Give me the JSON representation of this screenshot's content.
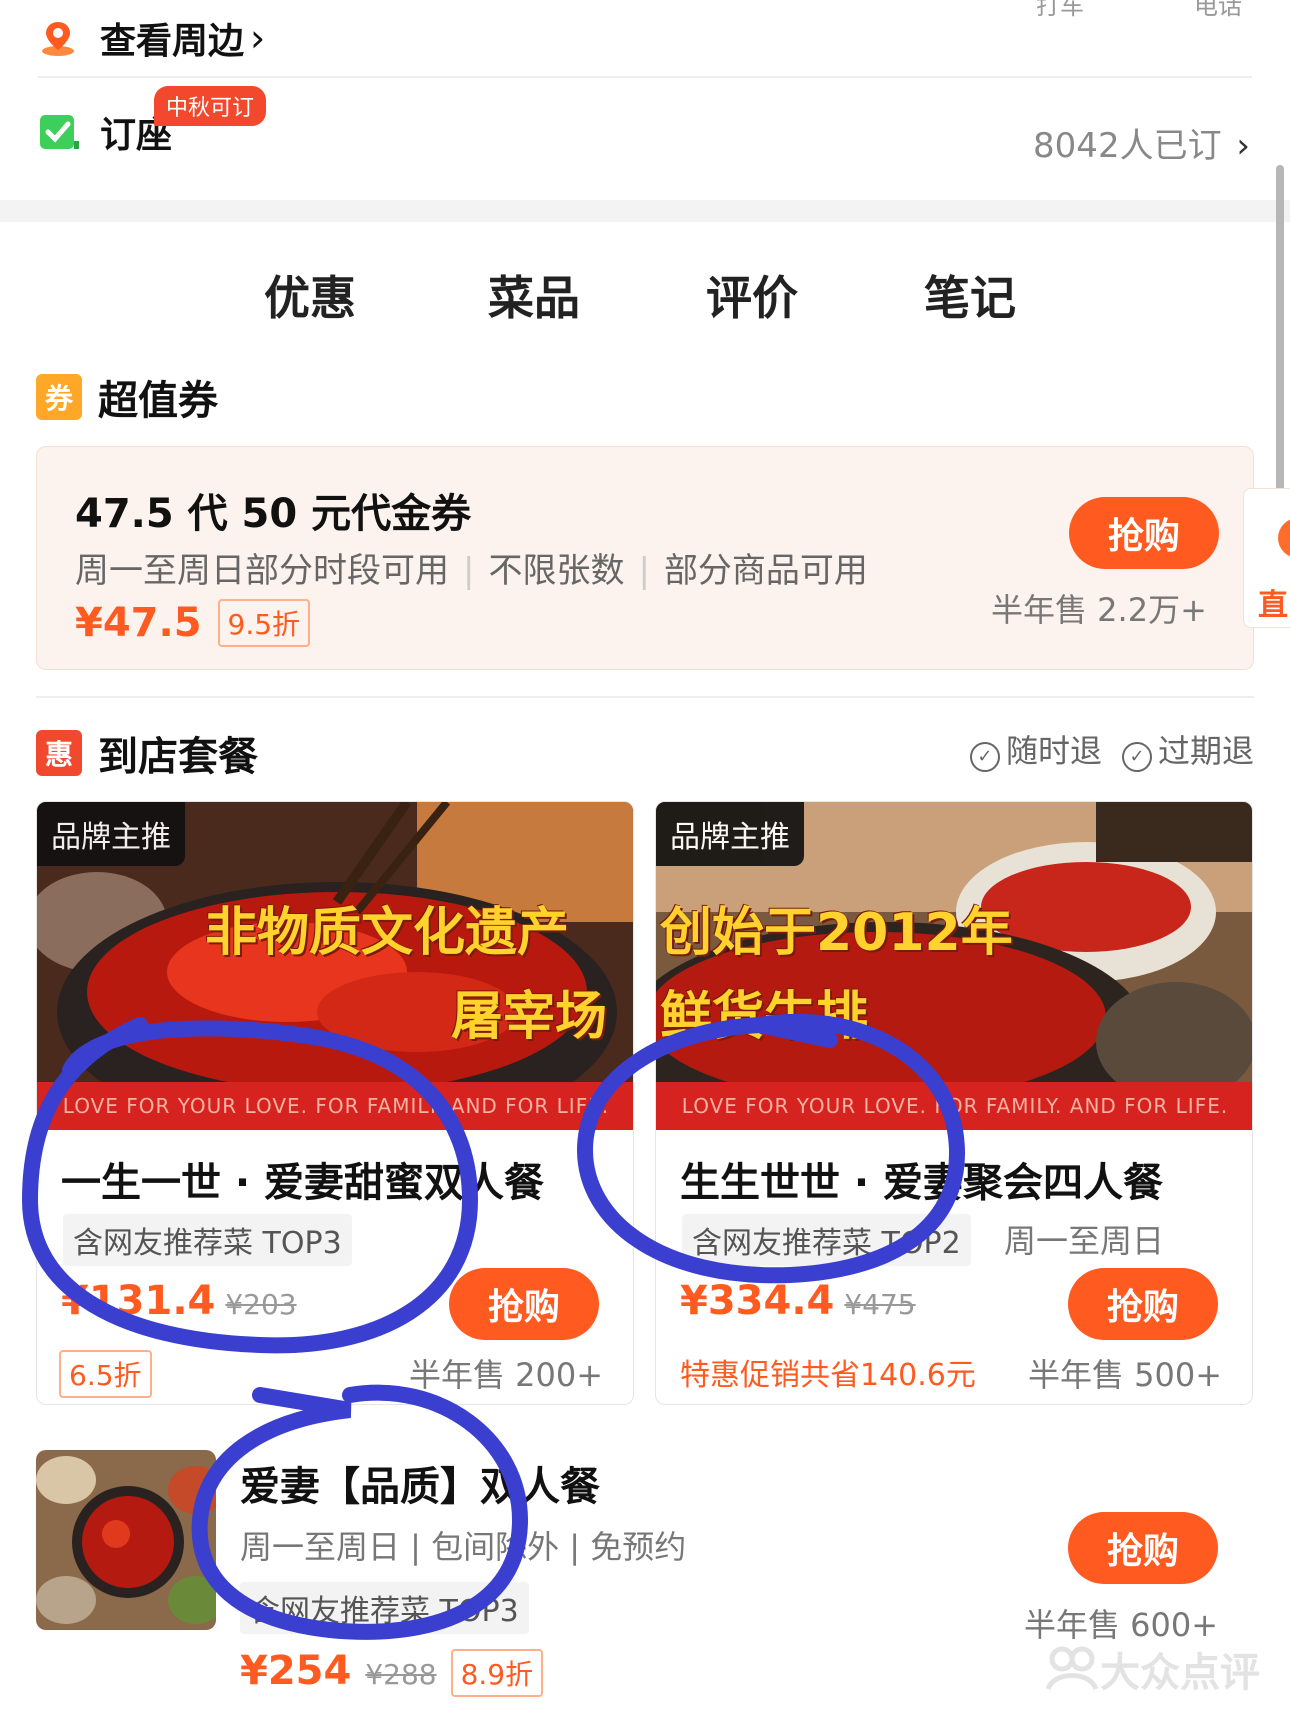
{
  "header": {
    "surround_label": "查看周边",
    "actions": [
      "打车",
      "电话"
    ],
    "seat_label": "订座",
    "seat_badge": "中秋可订",
    "seat_count": "8042人已订"
  },
  "tabs": [
    "优惠",
    "菜品",
    "评价",
    "笔记"
  ],
  "coupon_section": {
    "icon_text": "券",
    "title": "超值券",
    "coupon": {
      "title": "47.5 代 50 元代金券",
      "conditions": [
        "周一至周日部分时段可用",
        "不限张数",
        "部分商品可用"
      ],
      "price": "¥47.5",
      "discount": "9.5折",
      "buy_label": "抢购",
      "sold": "半年售 2.2万+"
    },
    "side_peek_text": "直"
  },
  "package_section": {
    "icon_text": "惠",
    "title": "到店套餐",
    "policies": [
      "随时退",
      "过期退"
    ],
    "cards": [
      {
        "brand_tag": "品牌主推",
        "slogan_top": "非物质文化遗产",
        "slogan_bottom": "屠宰场",
        "banner": "LOVE FOR YOUR LOVE. FOR FAMILY. AND FOR LIFE.",
        "title": "一生一世 · 爱妻甜蜜双人餐",
        "tag": "含网友推荐菜 TOP3",
        "days": "",
        "price": "¥131.4",
        "original": "¥203",
        "discount": "6.5折",
        "promo": "",
        "buy_label": "抢购",
        "sold": "半年售 200+"
      },
      {
        "brand_tag": "品牌主推",
        "slogan_top": "创始于2012年",
        "slogan_bottom": "鲜货牛排",
        "banner": "LOVE FOR YOUR LOVE. FOR FAMILY. AND FOR LIFE.",
        "title": "生生世世 · 爱妻聚会四人餐",
        "tag": "含网友推荐菜 TOP2",
        "days": "周一至周日",
        "price": "¥334.4",
        "original": "¥475",
        "discount": "",
        "promo": "特惠促销共省140.6元",
        "buy_label": "抢购",
        "sold": "半年售 500+"
      }
    ],
    "list_item": {
      "title": "爱妻【品质】双人餐",
      "desc": "周一至周日 | 包间除外 | 免预约",
      "tag": "含网友推荐菜 TOP3",
      "price": "¥254",
      "original": "¥288",
      "discount": "8.9折",
      "buy_label": "抢购",
      "sold": "半年售 600+"
    }
  },
  "watermark": "大众点评",
  "colors": {
    "accent": "#ff5a1f",
    "annotation": "#3b3fcf",
    "seat_icon": "#3ecf5a",
    "coupon_icon": "#ffa726"
  }
}
